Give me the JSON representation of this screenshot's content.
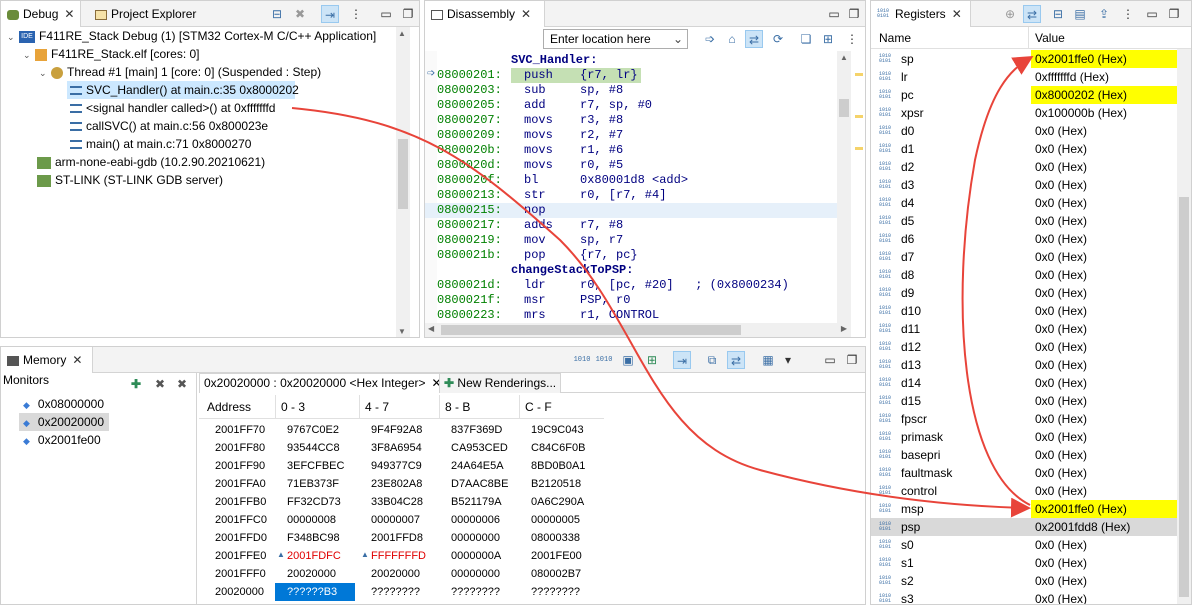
{
  "debug": {
    "tabs": [
      "Debug",
      "Project Explorer"
    ],
    "tree": [
      {
        "label": "F411RE_Stack Debug (1) [STM32 Cortex-M C/C++ Application]",
        "icon": "ide-icon"
      },
      {
        "label": "F411RE_Stack.elf [cores: 0]",
        "icon": "process-icon"
      },
      {
        "label": "Thread #1 [main] 1 [core: 0] (Suspended : Step)",
        "icon": "thread-icon"
      },
      {
        "label": "SVC_Handler() at main.c:35 0x8000202",
        "icon": "stackframe-icon"
      },
      {
        "label": "<signal handler called>() at 0xfffffffd",
        "icon": "stackframe-icon"
      },
      {
        "label": "callSVC() at main.c:56 0x800023e",
        "icon": "stackframe-icon"
      },
      {
        "label": "main() at main.c:71 0x8000270",
        "icon": "stackframe-icon"
      },
      {
        "label": "arm-none-eabi-gdb (10.2.90.20210621)",
        "icon": "gdb-icon"
      },
      {
        "label": "ST-LINK (ST-LINK GDB server)",
        "icon": "gdb-server-icon"
      }
    ]
  },
  "disassembly": {
    "tab": "Disassembly",
    "location_placeholder": "Enter location here",
    "lines": [
      {
        "label": "SVC_Handler:"
      },
      {
        "addr": "08000201:",
        "op": "push",
        "args": "{r7, lr}",
        "current": true
      },
      {
        "addr": "08000203:",
        "op": "sub",
        "args": "sp, #8"
      },
      {
        "addr": "08000205:",
        "op": "add",
        "args": "r7, sp, #0"
      },
      {
        "addr": "08000207:",
        "op": "movs",
        "args": "r3, #8"
      },
      {
        "addr": "08000209:",
        "op": "movs",
        "args": "r2, #7"
      },
      {
        "addr": "0800020b:",
        "op": "movs",
        "args": "r1, #6"
      },
      {
        "addr": "0800020d:",
        "op": "movs",
        "args": "r0, #5"
      },
      {
        "addr": "0800020f:",
        "op": "bl",
        "args": "0x80001d8 <add>"
      },
      {
        "addr": "08000213:",
        "op": "str",
        "args": "r0, [r7, #4]"
      },
      {
        "addr": "08000215:",
        "op": "nop",
        "args": "",
        "selected": true
      },
      {
        "addr": "08000217:",
        "op": "adds",
        "args": "r7, #8"
      },
      {
        "addr": "08000219:",
        "op": "mov",
        "args": "sp, r7"
      },
      {
        "addr": "0800021b:",
        "op": "pop",
        "args": "{r7, pc}"
      },
      {
        "label": "changeStackToPSP:"
      },
      {
        "addr": "0800021d:",
        "op": "ldr",
        "args": "r0, [pc, #20]   ; (0x8000234)"
      },
      {
        "addr": "0800021f:",
        "op": "msr",
        "args": "PSP, r0"
      },
      {
        "addr": "08000223:",
        "op": "mrs",
        "args": "r1, CONTROL"
      }
    ]
  },
  "registers": {
    "tab": "Registers",
    "col_name": "Name",
    "col_value": "Value",
    "highlight_color": "#ffff00",
    "rows": [
      {
        "name": "sp",
        "value": "0x2001ffe0 (Hex)",
        "hl": "yellow"
      },
      {
        "name": "lr",
        "value": "0xfffffffd (Hex)"
      },
      {
        "name": "pc",
        "value": "0x8000202 (Hex)",
        "hl": "yellow"
      },
      {
        "name": "xpsr",
        "value": "0x100000b (Hex)"
      },
      {
        "name": "d0",
        "value": "0x0 (Hex)"
      },
      {
        "name": "d1",
        "value": "0x0 (Hex)"
      },
      {
        "name": "d2",
        "value": "0x0 (Hex)"
      },
      {
        "name": "d3",
        "value": "0x0 (Hex)"
      },
      {
        "name": "d4",
        "value": "0x0 (Hex)"
      },
      {
        "name": "d5",
        "value": "0x0 (Hex)"
      },
      {
        "name": "d6",
        "value": "0x0 (Hex)"
      },
      {
        "name": "d7",
        "value": "0x0 (Hex)"
      },
      {
        "name": "d8",
        "value": "0x0 (Hex)"
      },
      {
        "name": "d9",
        "value": "0x0 (Hex)"
      },
      {
        "name": "d10",
        "value": "0x0 (Hex)"
      },
      {
        "name": "d11",
        "value": "0x0 (Hex)"
      },
      {
        "name": "d12",
        "value": "0x0 (Hex)"
      },
      {
        "name": "d13",
        "value": "0x0 (Hex)"
      },
      {
        "name": "d14",
        "value": "0x0 (Hex)"
      },
      {
        "name": "d15",
        "value": "0x0 (Hex)"
      },
      {
        "name": "fpscr",
        "value": "0x0 (Hex)"
      },
      {
        "name": "primask",
        "value": "0x0 (Hex)"
      },
      {
        "name": "basepri",
        "value": "0x0 (Hex)"
      },
      {
        "name": "faultmask",
        "value": "0x0 (Hex)"
      },
      {
        "name": "control",
        "value": "0x0 (Hex)"
      },
      {
        "name": "msp",
        "value": "0x2001ffe0 (Hex)",
        "hl": "yellow"
      },
      {
        "name": "psp",
        "value": "0x2001fdd8 (Hex)",
        "hl": "gray"
      },
      {
        "name": "s0",
        "value": "0x0 (Hex)"
      },
      {
        "name": "s1",
        "value": "0x0 (Hex)"
      },
      {
        "name": "s2",
        "value": "0x0 (Hex)"
      },
      {
        "name": "s3",
        "value": "0x0 (Hex)"
      }
    ]
  },
  "memory": {
    "tab": "Memory",
    "monitors_label": "Monitors",
    "monitors": [
      "0x08000000",
      "0x20020000",
      "0x2001fe00"
    ],
    "selected_monitor": 1,
    "rendering_tab": "0x20020000 : 0x20020000 <Hex Integer>",
    "new_renderings": "New Renderings...",
    "headers": [
      "Address",
      "0 - 3",
      "4 - 7",
      "8 - B",
      "C - F"
    ],
    "rows": [
      [
        "2001FF70",
        "9767C0E2",
        "9F4F92A8",
        "837F369D",
        "19C9C043"
      ],
      [
        "2001FF80",
        "93544CC8",
        "3F8A6954",
        "CA953CED",
        "C84C6F0B"
      ],
      [
        "2001FF90",
        "3EFCFBEC",
        "949377C9",
        "24A64E5A",
        "8BD0B0A1"
      ],
      [
        "2001FFA0",
        "71EB373F",
        "23E802A8",
        "D7AAC8BE",
        "B2120518"
      ],
      [
        "2001FFB0",
        "FF32CD73",
        "33B04C28",
        "B521179A",
        "0A6C290A"
      ],
      [
        "2001FFC0",
        "00000008",
        "00000007",
        "00000006",
        "00000005"
      ],
      [
        "2001FFD0",
        "F348BC98",
        "2001FFD8",
        "00000000",
        "08000338"
      ],
      [
        "2001FFE0",
        "2001FDFC",
        "FFFFFFFD",
        "0000000A",
        "2001FE00"
      ],
      [
        "2001FFF0",
        "20020000",
        "20020000",
        "00000000",
        "080002B7"
      ],
      [
        "20020000",
        "??????B3",
        "????????",
        "????????",
        "????????"
      ]
    ]
  }
}
